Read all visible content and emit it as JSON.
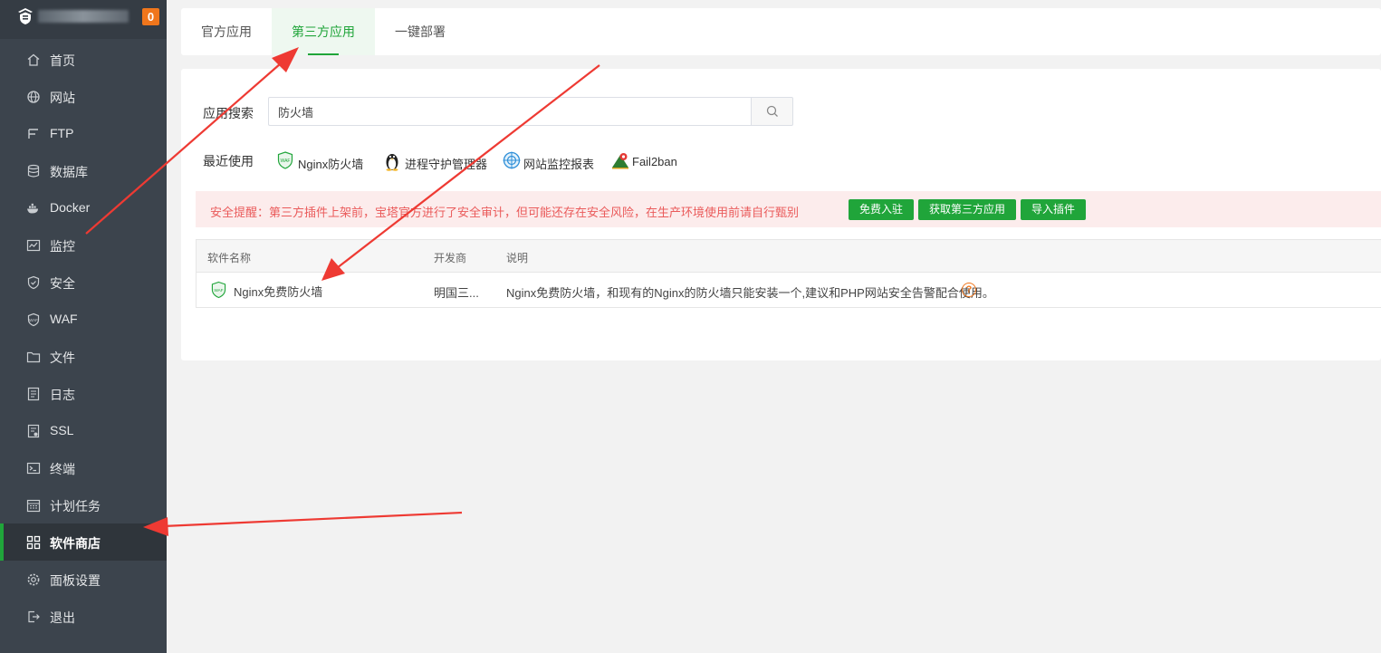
{
  "sidebar": {
    "badge": "0",
    "items": [
      {
        "label": "首页",
        "icon": "home-icon"
      },
      {
        "label": "网站",
        "icon": "globe-icon"
      },
      {
        "label": "FTP",
        "icon": "ftp-icon"
      },
      {
        "label": "数据库",
        "icon": "database-icon"
      },
      {
        "label": "Docker",
        "icon": "docker-icon"
      },
      {
        "label": "监控",
        "icon": "monitor-icon"
      },
      {
        "label": "安全",
        "icon": "shield-icon"
      },
      {
        "label": "WAF",
        "icon": "waf-icon"
      },
      {
        "label": "文件",
        "icon": "folder-icon"
      },
      {
        "label": "日志",
        "icon": "log-icon"
      },
      {
        "label": "SSL",
        "icon": "ssl-icon"
      },
      {
        "label": "终端",
        "icon": "terminal-icon"
      },
      {
        "label": "计划任务",
        "icon": "calendar-icon"
      },
      {
        "label": "软件商店",
        "icon": "grid-icon"
      },
      {
        "label": "面板设置",
        "icon": "gear-icon"
      },
      {
        "label": "退出",
        "icon": "logout-icon"
      }
    ],
    "active_label": "软件商店"
  },
  "tabs": [
    {
      "label": "官方应用"
    },
    {
      "label": "第三方应用"
    },
    {
      "label": "一键部署"
    }
  ],
  "search": {
    "label": "应用搜索",
    "value": "防火墙"
  },
  "recent": {
    "label": "最近使用",
    "items": [
      {
        "label": "Nginx防火墙",
        "icon": "waf-shield-icon"
      },
      {
        "label": "进程守护管理器",
        "icon": "penguin-icon"
      },
      {
        "label": "网站监控报表",
        "icon": "target-icon"
      },
      {
        "label": "Fail2ban",
        "icon": "fail2ban-icon"
      }
    ]
  },
  "alert": {
    "text": "安全提醒：第三方插件上架前，宝塔官方进行了安全审计，但可能还存在安全风险，在生产环境使用前请自行甄别",
    "buttons": [
      {
        "label": "免费入驻"
      },
      {
        "label": "获取第三方应用"
      },
      {
        "label": "导入插件"
      }
    ]
  },
  "table": {
    "headers": [
      "软件名称",
      "开发商",
      "说明"
    ],
    "rows": [
      {
        "name": "Nginx免费防火墙",
        "developer": "明国三...",
        "description": "Nginx免费防火墙，和现有的Nginx的防火墙只能安装一个,建议和PHP网站安全告警配合使用。",
        "help": "?"
      }
    ]
  },
  "colors": {
    "accent": "#20a53a",
    "sidebar_bg": "#3c444d",
    "alert_bg": "#fcecec",
    "alert_text": "#ea5b5b",
    "badge": "#f0761c",
    "annotation_arrow": "#ee3a33"
  }
}
